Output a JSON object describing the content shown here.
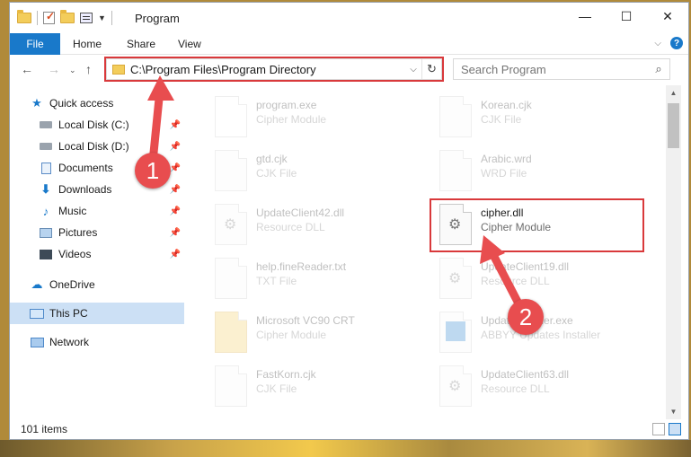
{
  "window": {
    "title": "Program",
    "controls": {
      "minimize": "—",
      "maximize": "☐",
      "close": "✕"
    }
  },
  "ribbon": {
    "tabs": [
      "File",
      "Home",
      "Share",
      "View"
    ],
    "help": "?"
  },
  "address": {
    "path": "C:\\Program Files\\Program Directory",
    "search_placeholder": "Search Program"
  },
  "sidebar": {
    "items": [
      {
        "label": "Quick access",
        "icon": "star-icon"
      },
      {
        "label": "Local Disk (C:)",
        "icon": "disk-icon",
        "pinned": true
      },
      {
        "label": "Local Disk (D:)",
        "icon": "disk-icon",
        "pinned": true
      },
      {
        "label": "Documents",
        "icon": "documents-icon",
        "pinned": true
      },
      {
        "label": "Downloads",
        "icon": "download-icon",
        "pinned": true
      },
      {
        "label": "Music",
        "icon": "music-icon",
        "pinned": true
      },
      {
        "label": "Pictures",
        "icon": "pictures-icon",
        "pinned": true
      },
      {
        "label": "Videos",
        "icon": "videos-icon",
        "pinned": true
      },
      {
        "label": "OneDrive",
        "icon": "cloud-icon"
      },
      {
        "label": "This PC",
        "icon": "pc-icon",
        "selected": true
      },
      {
        "label": "Network",
        "icon": "network-icon"
      }
    ]
  },
  "files": [
    {
      "name": "program.exe",
      "type": "Cipher Module"
    },
    {
      "name": "Korean.cjk",
      "type": "CJK File"
    },
    {
      "name": "gtd.cjk",
      "type": "CJK File"
    },
    {
      "name": "Arabic.wrd",
      "type": "WRD File"
    },
    {
      "name": "UpdateClient42.dll",
      "type": "Resource DLL"
    },
    {
      "name": "cipher.dll",
      "type": "Cipher Module",
      "highlighted": true
    },
    {
      "name": "help.fineReader.txt",
      "type": "TXT File"
    },
    {
      "name": "UpdateClient19.dll",
      "type": "Resource DLL"
    },
    {
      "name": "Microsoft VC90 CRT",
      "type": "Cipher Module"
    },
    {
      "name": "UpdateInstaller.exe",
      "type": "ABBYY Updates Installer"
    },
    {
      "name": "FastKorn.cjk",
      "type": "CJK File"
    },
    {
      "name": "UpdateClient63.dll",
      "type": "Resource DLL"
    }
  ],
  "status": {
    "items": "101 items"
  },
  "annotations": {
    "step1": "1",
    "step2": "2"
  },
  "colors": {
    "accent": "#1979ca",
    "highlight": "#d9393b",
    "selected_bg": "#cce0f5"
  }
}
